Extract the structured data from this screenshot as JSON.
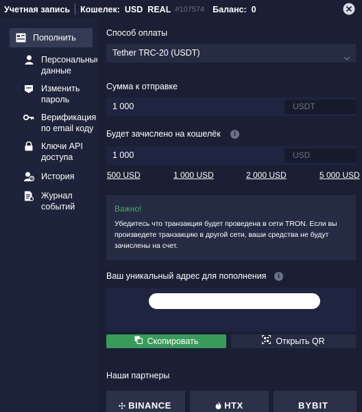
{
  "topbar": {
    "account_label": "Учетная запись",
    "wallet_label": "Кошелек:",
    "wallet_currency": "USD",
    "wallet_type": "REAL",
    "account_number": "#107574",
    "balance_label": "Баланс:",
    "balance_value": "0"
  },
  "sidebar": {
    "items": [
      {
        "label": "Пополнить",
        "icon": "deposit-icon",
        "active": true
      },
      {
        "label": "Персональные данные",
        "icon": "user-icon"
      },
      {
        "label": "Изменить пароль",
        "icon": "password-icon"
      },
      {
        "label": "Верификация по email коду",
        "icon": "key-icon"
      },
      {
        "label": "Ключи API доступа",
        "icon": "lock-icon"
      },
      {
        "label": "История",
        "icon": "history-icon"
      },
      {
        "label": "Журнал событий",
        "icon": "log-icon"
      }
    ]
  },
  "payment": {
    "method_label": "Способ оплаты",
    "method_value": "Tether TRC-20 (USDT)",
    "send_label": "Сумма к отправке",
    "send_value": "1 000",
    "send_currency": "USDT",
    "credit_label": "Будет зачислено на кошелёк",
    "credit_value": "1 000",
    "credit_currency": "USD",
    "quick_amounts": [
      "500 USD",
      "1 000 USD",
      "2 000 USD",
      "5 000 USD"
    ]
  },
  "notice": {
    "title": "Важно!",
    "text": "Убедитесь что транзакция будет проведена в сети TRON. Если вы произведете транзакцию в другой сети, ваши средства не будут зачислены на счет."
  },
  "address": {
    "label": "Ваш уникальный адрес для пополнения",
    "copy_button": "Скопировать",
    "qr_button": "Открыть QR"
  },
  "partners": {
    "label": "Наши партнеры",
    "names": [
      "BINANCE",
      "HTX",
      "BYBIT"
    ]
  },
  "colors": {
    "background": "#1a1f33",
    "accent_green": "#3a9a5b",
    "notice_title": "#4aa86b"
  }
}
